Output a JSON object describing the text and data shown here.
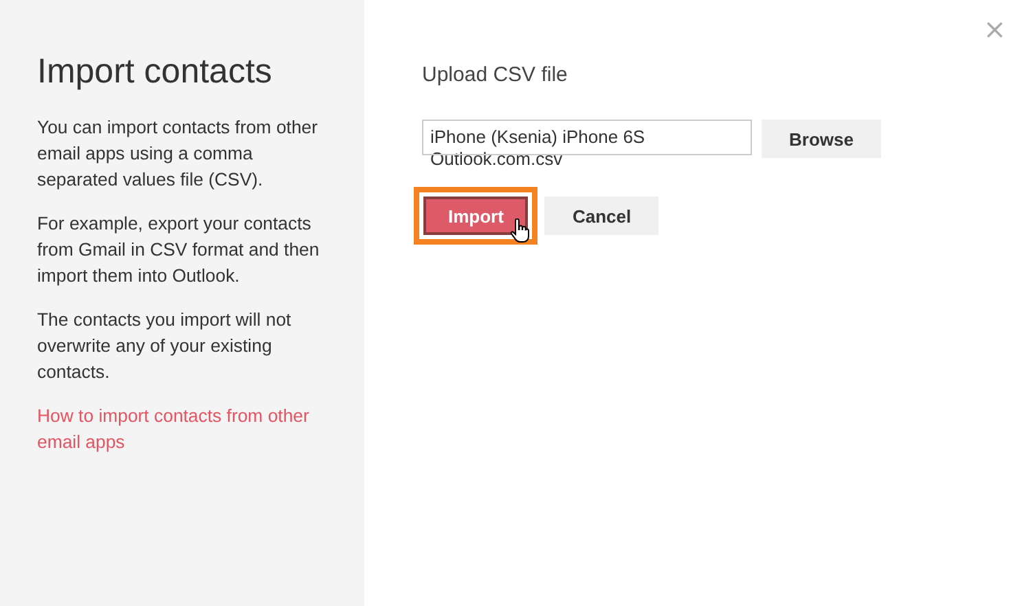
{
  "sidebar": {
    "title": "Import contacts",
    "paragraphs": [
      "You can import contacts from other email apps using a comma separated values file (CSV).",
      "For example, export your contacts from Gmail in CSV format and then import them into Outlook.",
      "The contacts you import will not overwrite any of your existing contacts."
    ],
    "link": "How to import contacts from other email apps"
  },
  "main": {
    "heading": "Upload CSV file",
    "file_field": {
      "value": "iPhone (Ksenia) iPhone 6S Outlook.com.csv"
    },
    "buttons": [
      {
        "label": "Browse",
        "kind": "secondary",
        "highlighted": false
      },
      {
        "label": "Import",
        "kind": "primary",
        "highlighted": true
      },
      {
        "label": "Cancel",
        "kind": "secondary",
        "highlighted": false
      }
    ]
  },
  "close_button": {
    "label": "×"
  }
}
